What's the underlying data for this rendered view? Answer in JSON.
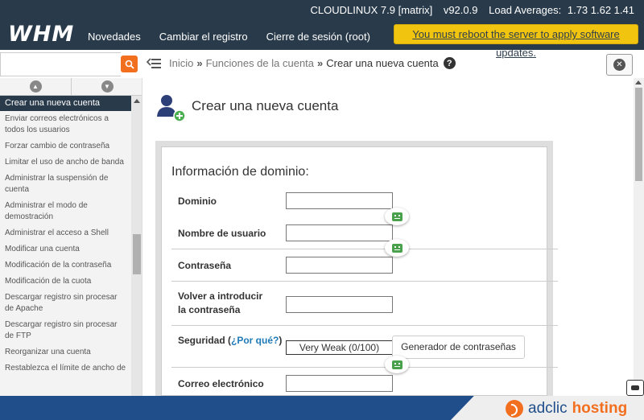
{
  "header": {
    "os": "CLOUDLINUX 7.9 [matrix]",
    "version": "v92.0.9",
    "load_label": "Load Averages:",
    "load_values": "1.73 1.62 1.41",
    "logo": "WHM",
    "nav": [
      "Novedades",
      "Cambiar el registro",
      "Cierre de sesión (root)"
    ],
    "reboot_notice": "You must reboot the server to apply software updates."
  },
  "search": {
    "value": "",
    "placeholder": ""
  },
  "breadcrumb": {
    "home": "Inicio",
    "section": "Funciones de la cuenta",
    "current": "Crear una nueva cuenta",
    "help": "?"
  },
  "sidebar": {
    "items": [
      "Crear una nueva cuenta",
      "Enviar correos electrónicos a todos los usuarios",
      "Forzar cambio de contraseña",
      "Limitar el uso de ancho de banda",
      "Administrar la suspensión de cuenta",
      "Administrar el modo de demostración",
      "Administrar el acceso a Shell",
      "Modificar una cuenta",
      "Modificación de la contraseña",
      "Modificación de la cuota",
      "Descargar registro sin procesar de Apache",
      "Descargar registro sin procesar de FTP",
      "Reorganizar una cuenta",
      "Restablezca el límite de ancho de"
    ]
  },
  "main": {
    "title": "Crear una nueva cuenta",
    "section": "Información de dominio:",
    "fields": {
      "domain": "Dominio",
      "username": "Nombre de usuario",
      "password": "Contraseña",
      "retype_1": "Volver a introducir",
      "retype_2": "la contraseña",
      "security_label": "Seguridad (",
      "security_link": "¿Por qué?",
      "security_close": ")",
      "email": "Correo electrónico"
    },
    "strength": "Very Weak (0/100)",
    "generator": "Generador de contraseñas"
  },
  "footer": {
    "brand_a": "adclic",
    "brand_h": "hosting"
  },
  "colors": {
    "header_bg": "#293a4a",
    "notice": "#f1c40f",
    "accent": "#f36f20",
    "link": "#1f7ab7",
    "footer": "#1f4e8a"
  }
}
